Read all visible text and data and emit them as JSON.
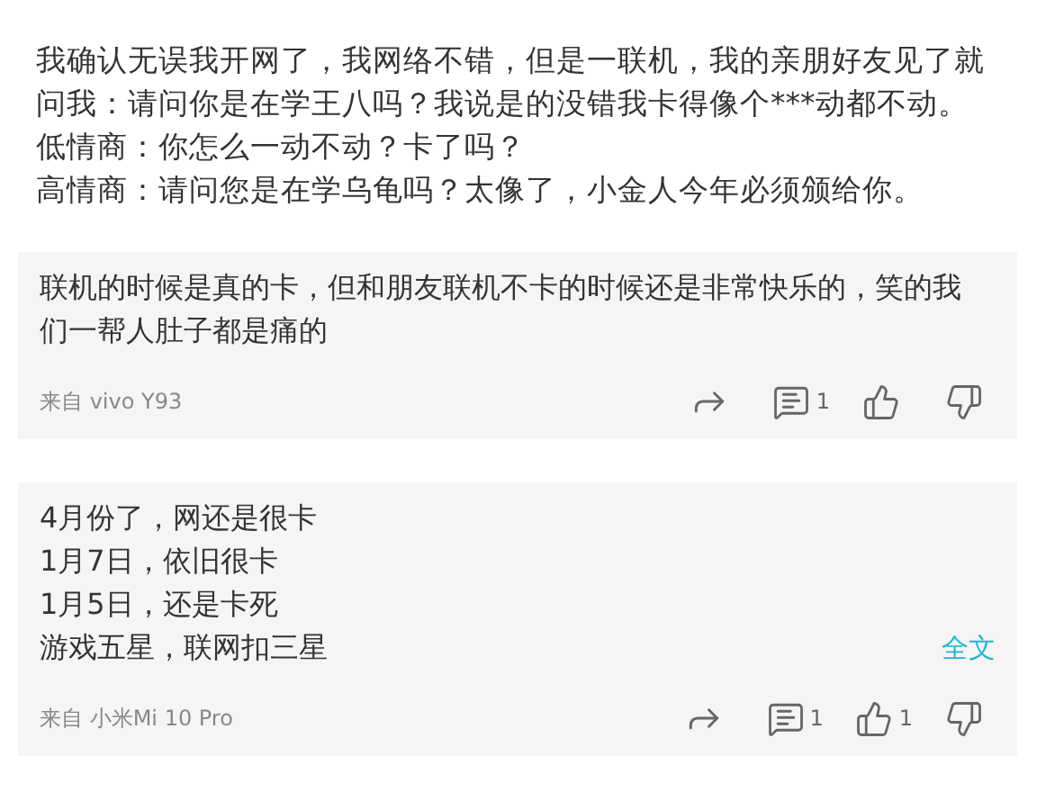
{
  "post": {
    "lines": [
      "我确认无误我开网了，我网络不错，但是一联机，我的亲朋好友见了就",
      "问我：请问你是在学王八吗？我说是的没错我卡得像个***动都不动。",
      "低情商：你怎么一动不动？卡了吗？",
      "高情商：请问您是在学乌龟吗？太像了，小金人今年必须颁给你。"
    ]
  },
  "comments": [
    {
      "lines": [
        "联机的时候是真的卡，但和朋友联机不卡的时候还是非常快乐的，笑的我",
        "们一帮人肚子都是痛的"
      ],
      "source": "来自 vivo Y93",
      "comment_count": "1"
    },
    {
      "lines": [
        "4月份了，网还是很卡",
        "1月7日，依旧很卡",
        "1月5日，还是卡死",
        "游戏五星，联网扣三星"
      ],
      "expand_link": "全文",
      "source": "来自 小米Mi 10 Pro",
      "comment_count": "1",
      "like_count": "1"
    }
  ]
}
